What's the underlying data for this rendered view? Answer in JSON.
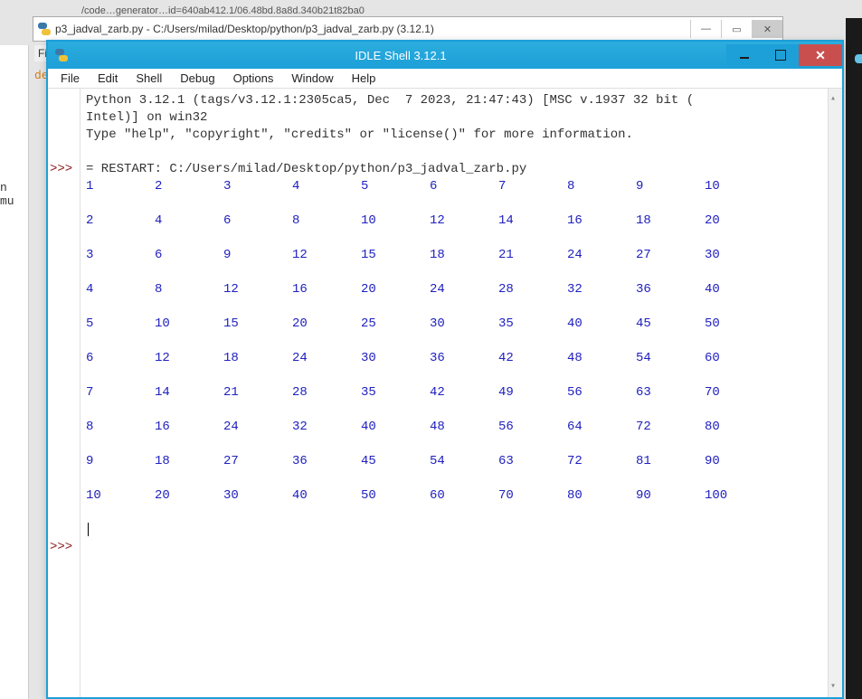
{
  "background": {
    "url_fragment": "/code…generator…id=640ab412.1/06.48bd.8a8d.340b21t82ba0",
    "editor_title": "p3_jadval_zarb.py - C:/Users/milad/Desktop/python/p3_jadval_zarb.py (3.12.1)",
    "left_text": "n\nmu",
    "file_label": "Fil",
    "orange_text": "de"
  },
  "shell": {
    "title": "IDLE Shell 3.12.1",
    "menus": [
      "File",
      "Edit",
      "Shell",
      "Debug",
      "Options",
      "Window",
      "Help"
    ],
    "info_line1": "Python 3.12.1 (tags/v3.12.1:2305ca5, Dec  7 2023, 21:47:43) [MSC v.1937 32 bit (",
    "info_line2": "Intel)] on win32",
    "info_line3": "Type \"help\", \"copyright\", \"credits\" or \"license()\" for more information.",
    "restart_line": "= RESTART: C:/Users/milad/Desktop/python/p3_jadval_zarb.py",
    "prompt": ">>>",
    "table": [
      [
        "1",
        "2",
        "3",
        "4",
        "5",
        "6",
        "7",
        "8",
        "9",
        "10"
      ],
      [
        "2",
        "4",
        "6",
        "8",
        "10",
        "12",
        "14",
        "16",
        "18",
        "20"
      ],
      [
        "3",
        "6",
        "9",
        "12",
        "15",
        "18",
        "21",
        "24",
        "27",
        "30"
      ],
      [
        "4",
        "8",
        "12",
        "16",
        "20",
        "24",
        "28",
        "32",
        "36",
        "40"
      ],
      [
        "5",
        "10",
        "15",
        "20",
        "25",
        "30",
        "35",
        "40",
        "45",
        "50"
      ],
      [
        "6",
        "12",
        "18",
        "24",
        "30",
        "36",
        "42",
        "48",
        "54",
        "60"
      ],
      [
        "7",
        "14",
        "21",
        "28",
        "35",
        "42",
        "49",
        "56",
        "63",
        "70"
      ],
      [
        "8",
        "16",
        "24",
        "32",
        "40",
        "48",
        "56",
        "64",
        "72",
        "80"
      ],
      [
        "9",
        "18",
        "27",
        "36",
        "45",
        "54",
        "63",
        "72",
        "81",
        "90"
      ],
      [
        "10",
        "20",
        "30",
        "40",
        "50",
        "60",
        "70",
        "80",
        "90",
        "100"
      ]
    ]
  }
}
